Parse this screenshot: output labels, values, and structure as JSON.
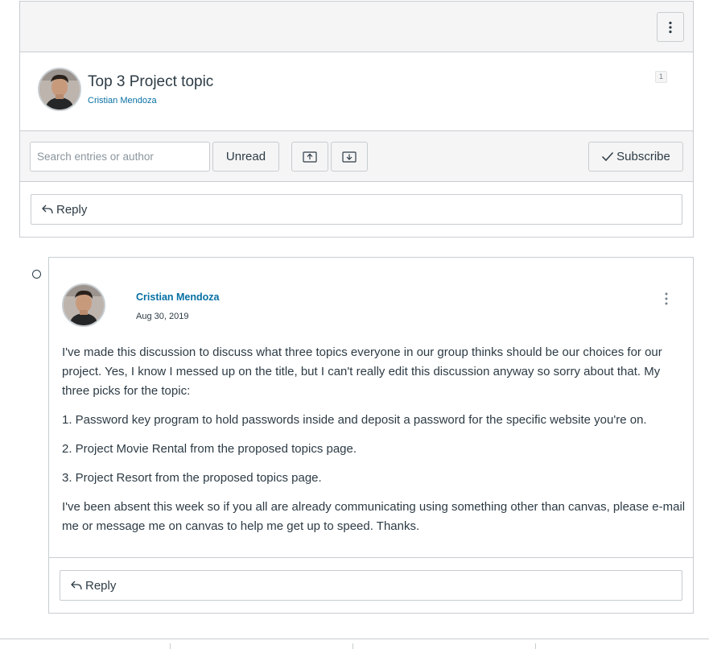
{
  "topic": {
    "title": "Top 3 Project topic",
    "author": "Cristian Mendoza",
    "reply_count": "1",
    "more_options_icon": "kebab-vertical-icon"
  },
  "toolbar": {
    "search_placeholder": "Search entries or author",
    "unread_label": "Unread",
    "collapse_icon": "arrow-up-box-icon",
    "expand_icon": "arrow-down-box-icon",
    "subscribe_label": "Subscribe",
    "subscribe_icon": "check-icon"
  },
  "topic_reply": {
    "label": "Reply",
    "icon": "reply-arrow-icon"
  },
  "entry": {
    "author": "Cristian Mendoza",
    "date": "Aug 30, 2019",
    "paragraphs": [
      "I've made this discussion to discuss what three topics everyone in our group thinks should be our choices for our project.  Yes, I know I messed up on the title, but I can't really edit this discussion anyway so sorry about that.  My three picks for the topic:",
      "1. Password key program to hold passwords inside and deposit a password for the specific website you're on.",
      "2. Project Movie Rental from the proposed topics page.",
      "3. Project Resort from the proposed topics page.",
      "I've been absent this week so if you all are already communicating using something other than canvas, please e-mail me or message me on canvas to help me get up to speed. Thanks."
    ],
    "reply_label": "Reply"
  },
  "colors": {
    "link": "#0770a3",
    "text": "#2d3b45",
    "border": "#c7cdd1",
    "bar_background": "#f5f5f5"
  }
}
